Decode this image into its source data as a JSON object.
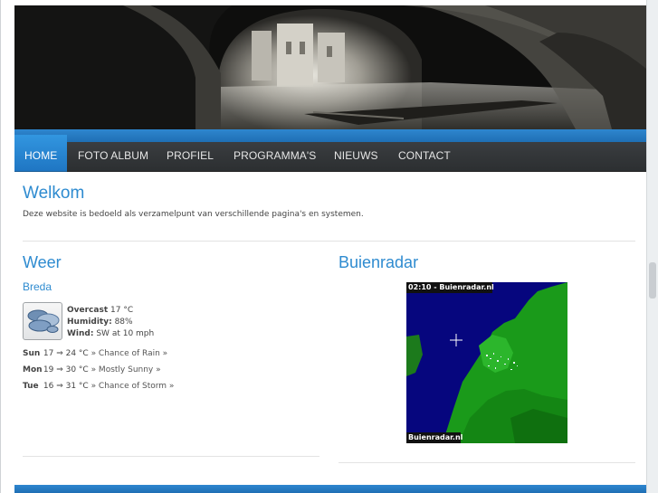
{
  "nav": {
    "items": [
      {
        "label": "HOME",
        "active": true
      },
      {
        "label": "FOTO ALBUM",
        "active": false
      },
      {
        "label": "PROFIEL",
        "active": false
      },
      {
        "label": "PROGRAMMA'S",
        "active": false
      },
      {
        "label": "NIEUWS",
        "active": false
      },
      {
        "label": "CONTACT",
        "active": false
      }
    ]
  },
  "welcome": {
    "title": "Welkom",
    "text": "Deze website is bedoeld als verzamelpunt van verschillende pagina's en systemen."
  },
  "weather": {
    "title": "Weer",
    "city": "Breda",
    "icon": "overcast-clouds-icon",
    "current": {
      "condition": "Overcast",
      "temp": "17 °C",
      "humidity_label": "Humidity:",
      "humidity": "88%",
      "wind_label": "Wind:",
      "wind": "SW at 10 mph"
    },
    "forecast": [
      {
        "day": "Sun",
        "range": "17 ⇒ 24 °C",
        "condition": "» Chance of Rain »"
      },
      {
        "day": "Mon",
        "range": "19 ⇒ 30 °C",
        "condition": "» Mostly Sunny »"
      },
      {
        "day": "Tue",
        "range": "16 ⇒ 31 °C",
        "condition": "» Chance of Storm »"
      }
    ]
  },
  "radar": {
    "title": "Buienradar",
    "time_label": "02:10 - Buienradar.nl",
    "footer_label": "Buienradar.nl"
  },
  "colors": {
    "accent": "#2e8bd0",
    "nav_bg": "#2f3234",
    "nav_active": "#2a8ad6"
  }
}
